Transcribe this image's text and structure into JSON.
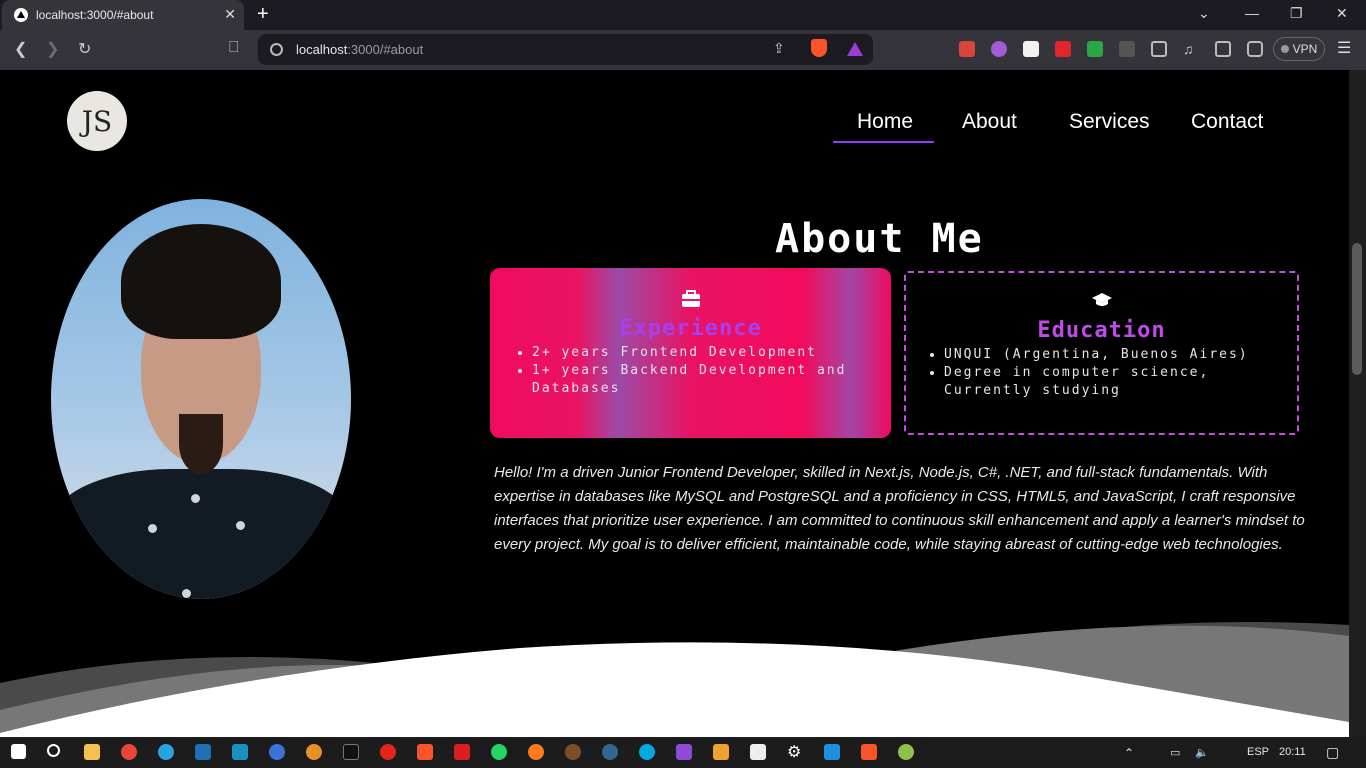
{
  "browser": {
    "tab_title": "localhost:3000/#about",
    "url_host": "localhost",
    "url_rest": ":3000/#about",
    "vpn_label": "VPN",
    "new_tab": "+",
    "close": "✕"
  },
  "site": {
    "logo_text": "JS",
    "nav": [
      {
        "label": "Home",
        "active": true
      },
      {
        "label": "About"
      },
      {
        "label": "Services"
      },
      {
        "label": "Contact"
      }
    ],
    "accent": "#8b3dff"
  },
  "about": {
    "title": "About Me",
    "experience": {
      "icon": "briefcase-icon",
      "title": "Experience",
      "items": [
        "2+ years Frontend Development",
        "1+ years Backend Development and Databases"
      ]
    },
    "education": {
      "icon": "graduation-cap-icon",
      "title": "Education",
      "items": [
        "UNQUI (Argentina, Buenos Aires)",
        "Degree in computer science, Currently studying"
      ]
    },
    "bio": "Hello! I'm a driven Junior Frontend Developer, skilled in Next.js, Node.js, C#, .NET, and full-stack fundamentals. With expertise in databases like MySQL and PostgreSQL and a proficiency in CSS, HTML5, and JavaScript, I craft responsive interfaces that prioritize user experience. I am committed to continuous skill enhancement and apply a learner's mindset to every project. My goal is to deliver efficient, maintainable code, while staying abreast of cutting-edge web technologies."
  },
  "taskbar": {
    "language": "ESP",
    "time": "20:11"
  }
}
